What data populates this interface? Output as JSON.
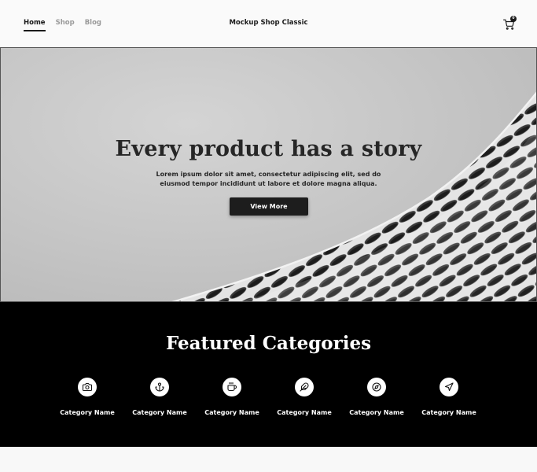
{
  "nav": {
    "links": [
      "Home",
      "Shop",
      "Blog"
    ],
    "active": "Home",
    "brand": "Mockup Shop Classic",
    "cart_icon": "cart-icon",
    "cart_count": "0"
  },
  "hero": {
    "title": "Every product has a story",
    "subtitle": "Lorem ipsum dolor sit amet, consectetur adipiscing elit, sed do eiusmod tempor incididunt ut labore et dolore magna aliqua.",
    "button_label": "View More",
    "image": "architecture-facade-image"
  },
  "featured": {
    "title": "Featured Categories",
    "categories": [
      {
        "label": "Category Name",
        "icon": "camera-icon"
      },
      {
        "label": "Category Name",
        "icon": "anchor-icon"
      },
      {
        "label": "Category Name",
        "icon": "coffee-icon"
      },
      {
        "label": "Category Name",
        "icon": "feather-icon"
      },
      {
        "label": "Category Name",
        "icon": "compass-icon"
      },
      {
        "label": "Category Name",
        "icon": "send-icon"
      }
    ]
  },
  "colors": {
    "background": "#fafafa",
    "text_dark": "#1a1a1a",
    "button": "#1d1d1d",
    "featured_bg": "#000000"
  }
}
